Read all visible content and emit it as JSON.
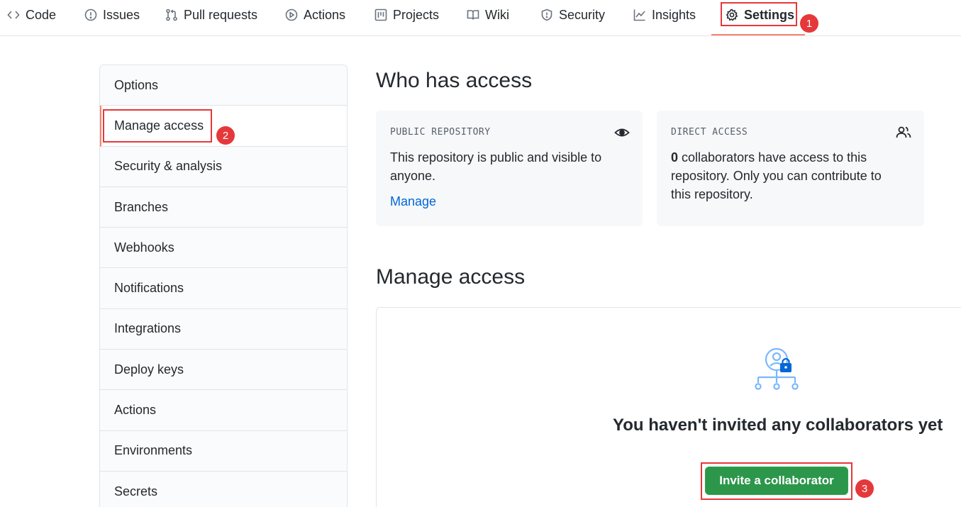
{
  "nav": {
    "tabs": [
      {
        "label": "Code",
        "icon": "code-icon"
      },
      {
        "label": "Issues",
        "icon": "issue-icon"
      },
      {
        "label": "Pull requests",
        "icon": "pull-request-icon"
      },
      {
        "label": "Actions",
        "icon": "play-icon"
      },
      {
        "label": "Projects",
        "icon": "project-icon"
      },
      {
        "label": "Wiki",
        "icon": "book-icon"
      },
      {
        "label": "Security",
        "icon": "shield-icon"
      },
      {
        "label": "Insights",
        "icon": "graph-icon"
      },
      {
        "label": "Settings",
        "icon": "gear-icon",
        "active": true
      }
    ]
  },
  "sidebar": {
    "items": [
      {
        "label": "Options"
      },
      {
        "label": "Manage access",
        "selected": true
      },
      {
        "label": "Security & analysis"
      },
      {
        "label": "Branches"
      },
      {
        "label": "Webhooks"
      },
      {
        "label": "Notifications"
      },
      {
        "label": "Integrations"
      },
      {
        "label": "Deploy keys"
      },
      {
        "label": "Actions"
      },
      {
        "label": "Environments"
      },
      {
        "label": "Secrets"
      }
    ]
  },
  "main": {
    "who_has_access_title": "Who has access",
    "public_card": {
      "label": "PUBLIC REPOSITORY",
      "icon": "eye-icon",
      "text": "This repository is public and visible to anyone.",
      "link": "Manage"
    },
    "direct_card": {
      "label": "DIRECT ACCESS",
      "icon": "people-icon",
      "count": "0",
      "text": " collaborators have access to this repository. Only you can contribute to this repository."
    },
    "manage_access_title": "Manage access",
    "empty_title": "You haven't invited any collaborators yet",
    "invite_button": "Invite a collaborator"
  },
  "annotations": {
    "step1": "1",
    "step2": "2",
    "step3": "3"
  },
  "colors": {
    "accent_underline": "#f9826c",
    "highlight_red": "#e5383b",
    "link_blue": "#0366d6",
    "button_green": "#2c974b"
  }
}
